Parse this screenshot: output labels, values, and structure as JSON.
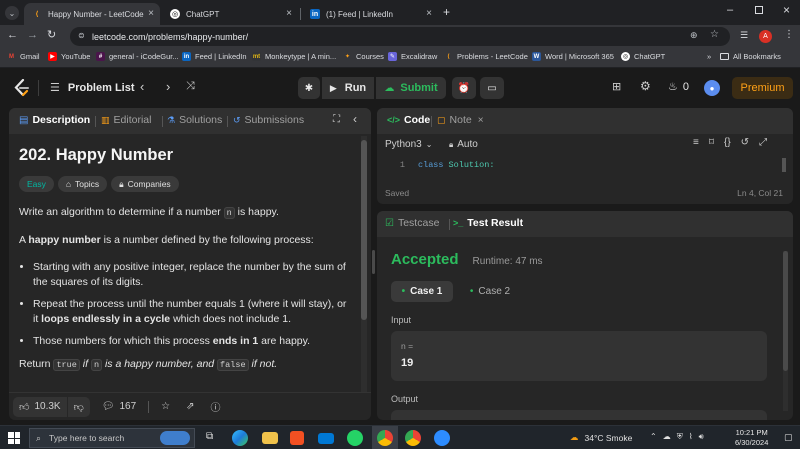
{
  "browser": {
    "tabs": [
      {
        "title": "Happy Number - LeetCode",
        "active": true
      },
      {
        "title": "ChatGPT",
        "active": false
      },
      {
        "title": "(1) Feed | LinkedIn",
        "active": false
      }
    ],
    "url": "leetcode.com/problems/happy-number/",
    "profile_initial": "A",
    "bookmarks": [
      {
        "label": "Gmail",
        "icon": "gmail-icon"
      },
      {
        "label": "YouTube",
        "icon": "youtube-icon"
      },
      {
        "label": "general - iCodeGur...",
        "icon": "slack-icon"
      },
      {
        "label": "Feed | LinkedIn",
        "icon": "linkedin-icon"
      },
      {
        "label": "Monkeytype | A min...",
        "icon": "monkeytype-icon"
      },
      {
        "label": "Courses",
        "icon": "courses-icon"
      },
      {
        "label": "Excalidraw",
        "icon": "excalidraw-icon"
      },
      {
        "label": "Problems - LeetCode",
        "icon": "leetcode-icon"
      },
      {
        "label": "Word | Microsoft 365",
        "icon": "word-icon"
      },
      {
        "label": "ChatGPT",
        "icon": "chatgpt-icon"
      }
    ],
    "more_bookmarks": "»",
    "all_bookmarks": "All Bookmarks"
  },
  "lc_nav": {
    "problem_list": "Problem List",
    "run": "Run",
    "submit": "Submit",
    "streak": "0",
    "premium": "Premium"
  },
  "left_panel": {
    "tabs": [
      "Description",
      "Editorial",
      "Solutions",
      "Submissions"
    ],
    "title": "202. Happy Number",
    "difficulty": "Easy",
    "topics": "Topics",
    "companies": "Companies",
    "p1_a": "Write an algorithm to determine if a number ",
    "p1_code": "n",
    "p1_b": " is happy.",
    "p2_a": "A ",
    "p2_bold": "happy number",
    "p2_b": " is a number defined by the following process:",
    "bullet1": "Starting with any positive integer, replace the number by the sum of the squares of its digits.",
    "bullet2_a": "Repeat the process until the number equals 1 (where it will stay), or it ",
    "bullet2_bold": "loops endlessly in a cycle",
    "bullet2_b": " which does not include 1.",
    "bullet3_a": "Those numbers for which this process ",
    "bullet3_bold": "ends in 1",
    "bullet3_b": " are happy.",
    "ret_a": "Return ",
    "ret_code1": "true",
    "ret_b": " if ",
    "ret_code2": "n",
    "ret_c": " is a happy number, and ",
    "ret_code3": "false",
    "ret_d": " if not.",
    "likes": "10.3K",
    "comments": "167"
  },
  "code_panel": {
    "tabs": [
      "Code",
      "Note"
    ],
    "language": "Python3",
    "mode": "Auto",
    "line_no": "1",
    "code_kw": "class",
    "code_name": "Solution:",
    "status": "Saved",
    "cursor": "Ln 4, Col 21"
  },
  "result_panel": {
    "tabs": [
      "Testcase",
      "Test Result"
    ],
    "verdict": "Accepted",
    "runtime": "Runtime: 47 ms",
    "cases": [
      "Case 1",
      "Case 2"
    ],
    "input_label": "Input",
    "var_name": "n =",
    "var_value": "19",
    "output_label": "Output"
  },
  "taskbar": {
    "search_placeholder": "Type here to search",
    "weather": "34°C  Smoke",
    "time": "10:21 PM",
    "date": "6/30/2024"
  },
  "colors": {
    "accepted": "#2cbb5d",
    "easy": "#00b8a3",
    "premium": "#ffa116",
    "submit": "#2cbb5d"
  }
}
